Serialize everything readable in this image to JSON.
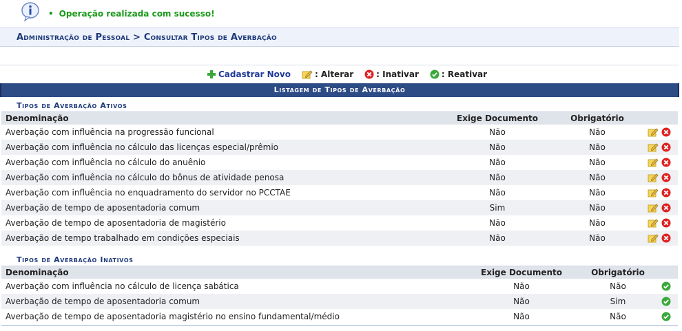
{
  "message": {
    "text": "Operação realizada com sucesso!"
  },
  "breadcrumb": {
    "text": "Administração de Pessoal > Consultar Tipos de Averbação"
  },
  "actions": {
    "new_label": "Cadastrar Novo",
    "alter_label": ": Alterar",
    "inactivate_label": ": Inativar",
    "reactivate_label": ": Reativar"
  },
  "list": {
    "title": "Listagem de Tipos de Averbação"
  },
  "active": {
    "title": "Tipos de Averbação Ativos",
    "columns": {
      "name": "Denominação",
      "doc": "Exige Documento",
      "req": "Obrigatório"
    },
    "rows": [
      {
        "name": "Averbação com influência na progressão funcional",
        "doc": "Não",
        "req": "Não"
      },
      {
        "name": "Averbação com influência no cálculo das licenças especial/prêmio",
        "doc": "Não",
        "req": "Não"
      },
      {
        "name": "Averbação com influência no cálculo do anuênio",
        "doc": "Não",
        "req": "Não"
      },
      {
        "name": "Averbação com influência no cálculo do bônus de atividade penosa",
        "doc": "Não",
        "req": "Não"
      },
      {
        "name": "Averbação com influência no enquadramento do servidor no PCCTAE",
        "doc": "Não",
        "req": "Não"
      },
      {
        "name": "Averbação de tempo de aposentadoria comum",
        "doc": "Sim",
        "req": "Não"
      },
      {
        "name": "Averbação de tempo de aposentadoria de magistério",
        "doc": "Não",
        "req": "Não"
      },
      {
        "name": "Averbação de tempo trabalhado em condições especiais",
        "doc": "Não",
        "req": "Não"
      }
    ]
  },
  "inactive": {
    "title": "Tipos de Averbação Inativos",
    "columns": {
      "name": "Denominação",
      "doc": "Exige Documento",
      "req": "Obrigatório"
    },
    "rows": [
      {
        "name": "Averbação com influência no cálculo de licença sabática",
        "doc": "Não",
        "req": "Não"
      },
      {
        "name": "Averbação de tempo de aposentadoria comum",
        "doc": "Não",
        "req": "Sim"
      },
      {
        "name": "Averbação de tempo de aposentadoria magistério no ensino fundamental/médio",
        "doc": "Não",
        "req": "Não"
      }
    ]
  },
  "icons": {
    "info": "info-icon",
    "add": "plus-icon",
    "alter": "pencil-note-icon",
    "inactivate": "red-x-icon",
    "reactivate": "green-check-icon"
  },
  "colors": {
    "success": "#1a9a1a",
    "header_bg": "#2d4b84",
    "title_blue": "#1f3a7a",
    "delete_red": "#e02020",
    "check_green": "#3aa83a"
  }
}
